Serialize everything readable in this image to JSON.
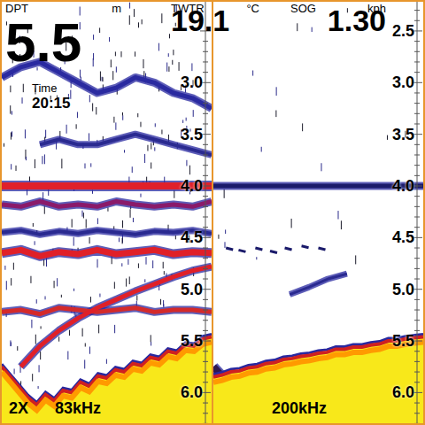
{
  "readouts": [
    {
      "label": "DPT",
      "unit": "m",
      "value": "5.5"
    },
    {
      "label": "TWTR",
      "unit": "°C",
      "value": "19.1"
    },
    {
      "label": "SOG",
      "unit": "kph",
      "value": "1.30"
    }
  ],
  "time": {
    "label": "Time",
    "value": "20:15"
  },
  "panels": [
    {
      "zoom": "2X",
      "frequency": "83kHz",
      "clutter": 0.6,
      "scale": [
        "3.0",
        "3.5",
        "4.0",
        "4.5",
        "5.0",
        "5.5",
        "6.0"
      ],
      "bottom": [
        5.75,
        5.85,
        5.95,
        6.05,
        6.12,
        6.02,
        6.08,
        5.98,
        6.0,
        5.9,
        5.94,
        5.84,
        5.86,
        5.78,
        5.8,
        5.72,
        5.74,
        5.66,
        5.68,
        5.6,
        5.62,
        5.54,
        5.55,
        5.48,
        5.46
      ],
      "echoes": [
        {
          "depths": [
            2.95,
            2.85,
            2.8,
            2.9,
            3.0,
            3.1,
            3.05,
            2.95,
            3.0,
            3.1,
            3.15,
            3.25
          ],
          "width": 5,
          "color": "#2a2aa0"
        },
        {
          "depths": [
            null,
            null,
            3.6,
            3.55,
            3.6,
            3.6,
            3.55,
            3.5,
            3.55,
            3.6,
            3.65,
            3.7
          ],
          "width": 4,
          "color": "#2a2a90"
        },
        {
          "depths": [
            4.0,
            4.0,
            4.0,
            4.0,
            4.0,
            4.0,
            4.0,
            4.0,
            4.0,
            4.0,
            4.0,
            4.0
          ],
          "width": 8,
          "color": "#e0202a"
        },
        {
          "depths": [
            4.18,
            4.2,
            4.15,
            4.2,
            4.18,
            4.2,
            4.15,
            4.18,
            4.2,
            4.18,
            4.2,
            4.15
          ],
          "width": 5,
          "color": "#8a1a6a"
        },
        {
          "depths": [
            4.45,
            4.43,
            4.47,
            4.44,
            4.46,
            4.43,
            4.45,
            4.47,
            4.44,
            4.45,
            4.43,
            4.46
          ],
          "width": 4,
          "color": "#2a2a90"
        },
        {
          "depths": [
            4.65,
            4.62,
            4.68,
            4.64,
            4.66,
            4.62,
            4.66,
            4.64,
            4.62,
            4.66,
            4.64,
            4.65
          ],
          "width": 7,
          "color": "#e02028"
        },
        {
          "depths": [
            5.22,
            5.2,
            5.24,
            5.18,
            5.2,
            5.22,
            5.2,
            5.18,
            5.22,
            5.2,
            5.2,
            5.22
          ],
          "width": 5,
          "color": "#d42a2a"
        },
        {
          "depths": [
            null,
            5.75,
            5.55,
            5.4,
            5.28,
            5.18,
            5.1,
            5.02,
            4.95,
            4.88,
            4.82,
            4.78
          ],
          "width": 5,
          "color": "#e02028"
        }
      ],
      "marks": []
    },
    {
      "frequency": "200kHz",
      "clutter": 0.05,
      "scale": [
        "2.5",
        "3.0",
        "3.5",
        "4.0",
        "4.5",
        "5.0",
        "5.5",
        "6.0"
      ],
      "bottom": [
        5.85,
        5.83,
        5.8,
        5.79,
        5.76,
        5.75,
        5.72,
        5.71,
        5.68,
        5.67,
        5.65,
        5.64,
        5.62,
        5.61,
        5.58,
        5.58,
        5.56,
        5.56,
        5.54,
        5.53,
        5.5,
        5.5,
        5.48,
        5.47,
        5.46
      ],
      "echoes": [
        {
          "depths": [
            4.0,
            4.0,
            4.0,
            4.0,
            4.0,
            4.0,
            4.0,
            4.0,
            4.0,
            4.0,
            4.0,
            4.0
          ],
          "width": 5,
          "color": "#1a1a6a"
        },
        {
          "depths": [
            null,
            null,
            null,
            null,
            5.05,
            4.98,
            4.9,
            4.85,
            null,
            null,
            null,
            null
          ],
          "width": 3,
          "color": "#2a2a90"
        },
        {
          "depths": [
            5.75,
            5.95,
            null,
            null,
            null,
            null,
            null,
            null,
            null,
            null,
            null,
            null
          ],
          "width": 8,
          "color": "#301850"
        }
      ],
      "marks": [
        {
          "x": 0.06,
          "depth": 4.6
        },
        {
          "x": 0.12,
          "depth": 4.62
        },
        {
          "x": 0.2,
          "depth": 4.6
        },
        {
          "x": 0.27,
          "depth": 4.63
        },
        {
          "x": 0.34,
          "depth": 4.6
        },
        {
          "x": 0.42,
          "depth": 4.58
        },
        {
          "x": 0.5,
          "depth": 4.6
        }
      ]
    }
  ]
}
